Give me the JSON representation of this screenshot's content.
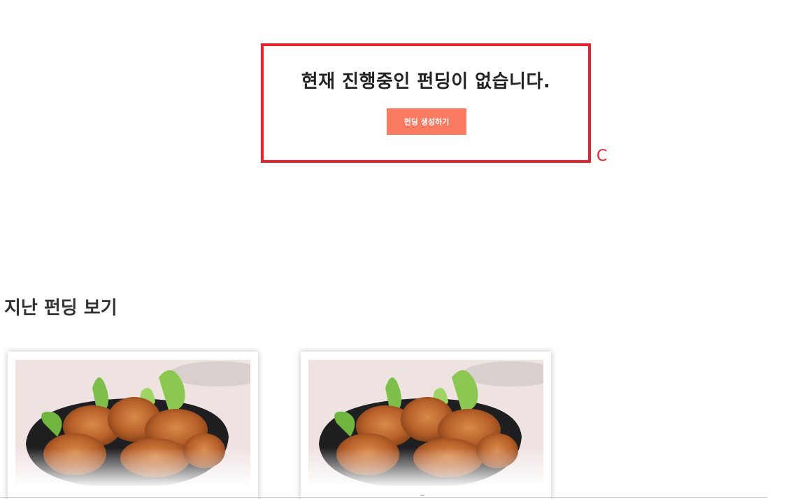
{
  "current_funding": {
    "empty_message": "현재 진행중인 펀딩이 없습니다.",
    "create_button_label": "펀딩 생성하기",
    "annotation_letter": "C"
  },
  "past_funding": {
    "title": "지난 펀딩 보기",
    "cards": [
      {
        "image": "fried-chicken-bowl-photo"
      },
      {
        "image": "fried-chicken-bowl-photo"
      }
    ]
  },
  "colors": {
    "highlight_border": "#e52330",
    "button_bg": "#fa7b61",
    "text": "#222222"
  }
}
